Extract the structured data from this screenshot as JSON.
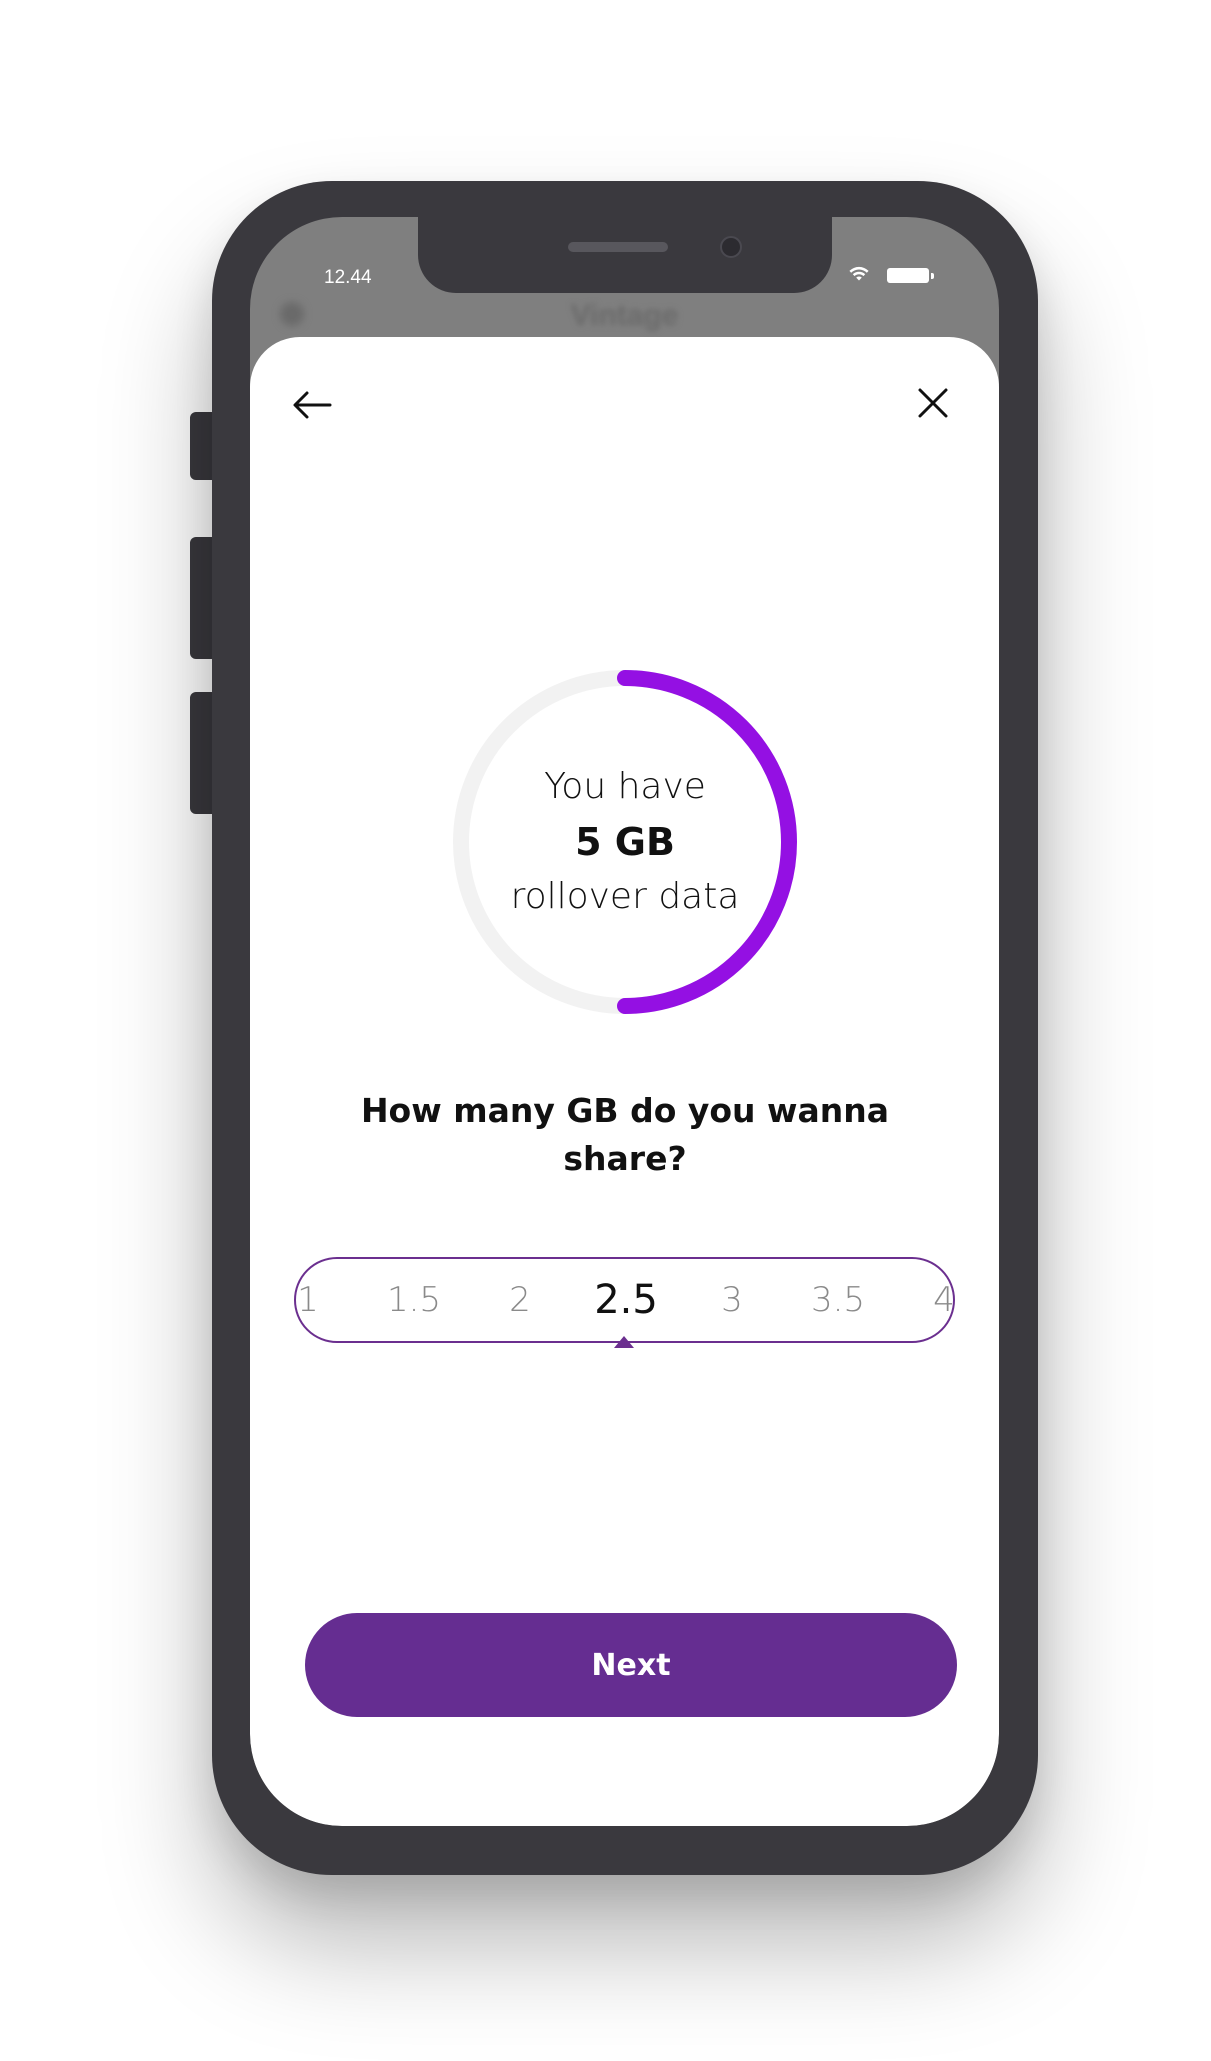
{
  "status_bar": {
    "time": "12.44",
    "wifi_icon": "wifi-icon",
    "battery_icon": "battery-icon"
  },
  "background_screen": {
    "title": "Vintage"
  },
  "sheet": {
    "back_icon": "arrow-left-icon",
    "close_icon": "close-icon"
  },
  "data_ring": {
    "line1": "You have",
    "amount": "5 GB",
    "line3": "rollover data",
    "fill_fraction": 0.5,
    "track_color": "#f2f2f2",
    "fill_color": "#9410e3"
  },
  "question": "How many GB do you wanna share?",
  "picker": {
    "options": [
      "1",
      "1.5",
      "2",
      "2.5",
      "3",
      "3.5",
      "4"
    ],
    "selected_index": 3,
    "border_color": "#6b2f8f"
  },
  "next_button": {
    "label": "Next",
    "color": "#652d91"
  }
}
